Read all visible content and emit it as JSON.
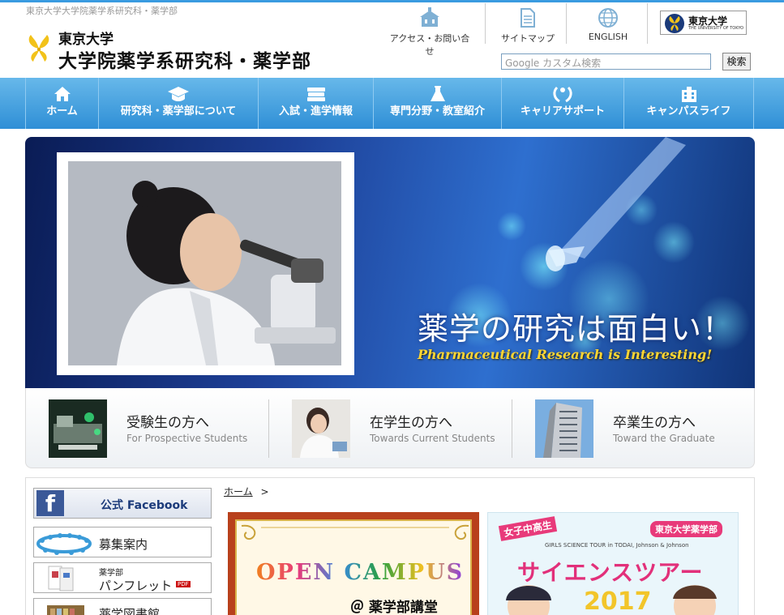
{
  "header": {
    "tagline": "東京大学大学院薬学系研究科・薬学部",
    "logo_small": "東京大学",
    "logo_big": "大学院薬学系研究科・薬学部",
    "util": [
      {
        "label": "アクセス・お問い合せ",
        "icon": "building-icon"
      },
      {
        "label": "サイトマップ",
        "icon": "document-icon"
      },
      {
        "label": "ENGLISH",
        "icon": "globe-icon"
      }
    ],
    "utokyo_badge": "東京大学",
    "utokyo_badge_sub": "THE UNIVERSITY OF TOKYO",
    "search_placeholder": "Google カスタム検索",
    "search_button": "検索"
  },
  "nav": {
    "items": [
      {
        "label": "ホーム",
        "icon": "home-icon"
      },
      {
        "label": "研究科・薬学部について",
        "icon": "graduation-cap-icon"
      },
      {
        "label": "入試・進学情報",
        "icon": "books-icon"
      },
      {
        "label": "専門分野・教室紹介",
        "icon": "flask-icon"
      },
      {
        "label": "キャリアサポート",
        "icon": "wreath-icon"
      },
      {
        "label": "キャンパスライフ",
        "icon": "campus-building-icon"
      }
    ]
  },
  "hero": {
    "title": "薬学の研究は面白い！",
    "subtitle": "Pharmaceutical Research is Interesting!"
  },
  "audience": [
    {
      "jp": "受験生の方へ",
      "en": "For Prospective Students"
    },
    {
      "jp": "在学生の方へ",
      "en": "Towards Current Students"
    },
    {
      "jp": "卒業生の方へ",
      "en": "Toward the Graduate"
    }
  ],
  "sidebar": {
    "facebook": "公式 Facebook",
    "recruit": "募集案内",
    "pamphlet_small": "薬学部",
    "pamphlet_big": "パンフレット",
    "pamphlet_badge": "PDF",
    "library": "薬学図書館"
  },
  "breadcrumb": {
    "home": "ホーム",
    "sep": ">"
  },
  "banners": {
    "open_campus_title": "OPEN CAMPUS",
    "open_campus_sub": "＠ 薬学部講堂",
    "science_tour_tag": "東京大学薬学部",
    "science_tour_girls": "女子中高生",
    "science_tour_small": "GIRLS SCIENCE TOUR in TODAI, Johnson & Johnson",
    "science_tour_title": "サイエンスツアー",
    "science_tour_year": "2017"
  },
  "colors": {
    "nav_top": "#67b8ea",
    "nav_bottom": "#2f8fd6",
    "hero_sub": "#ffd633",
    "accent_pink": "#e83a7a"
  }
}
